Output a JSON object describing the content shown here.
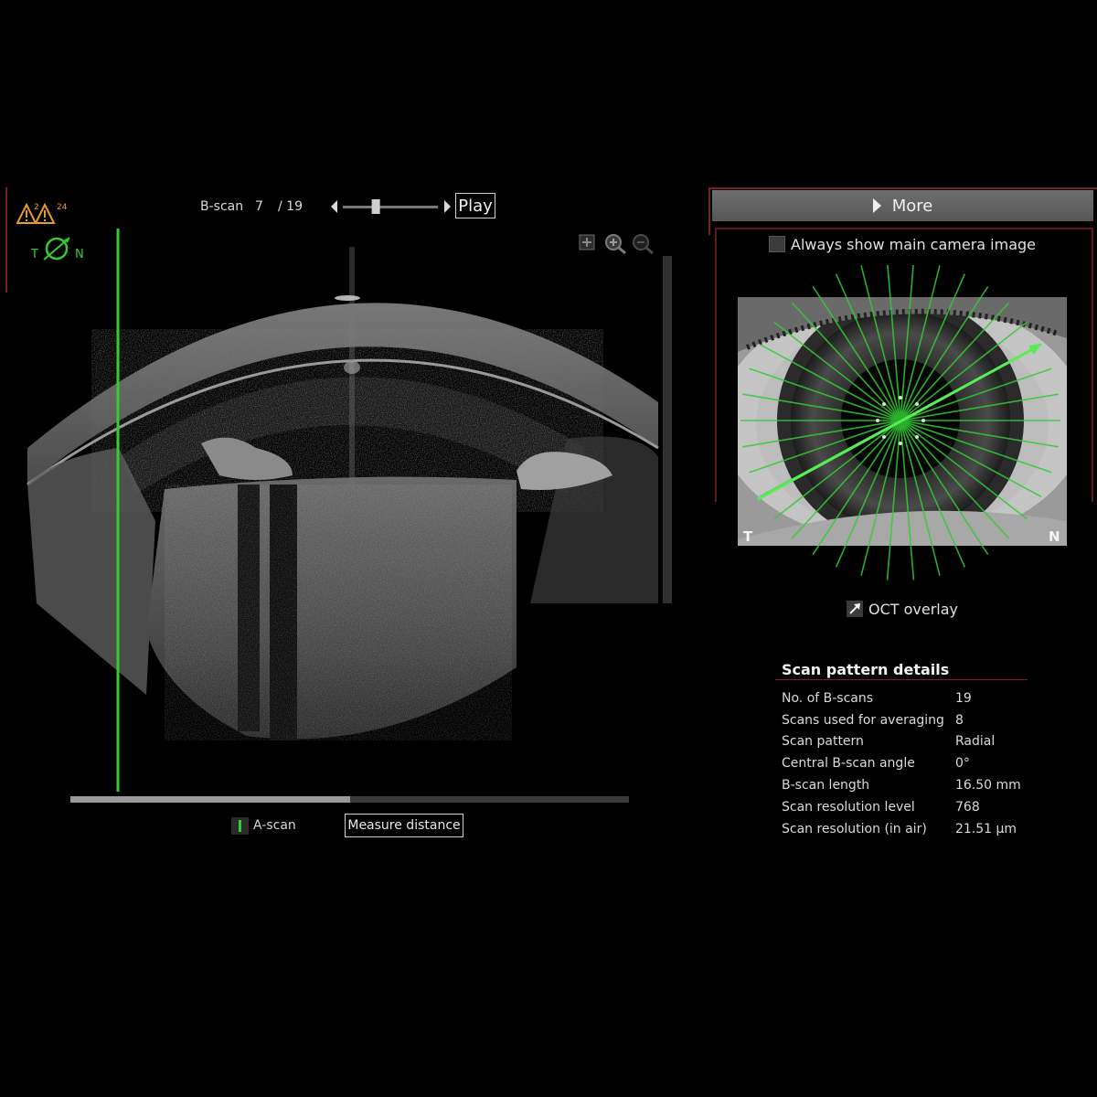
{
  "viewer": {
    "warning": {
      "sup_a": "2",
      "sup_b": "24"
    },
    "orientation": {
      "left": "T",
      "right": "N"
    },
    "bscan": {
      "label": "B-scan",
      "current": "7",
      "total": "/ 19",
      "progress": 0.333
    },
    "play_label": "Play",
    "position_fraction": 0.5,
    "a_scan_label": "A-scan",
    "measure_label": "Measure distance"
  },
  "panel": {
    "more_label": "More",
    "camera_checkbox_label": "Always show main camera image",
    "camera_corner_left": "T",
    "camera_corner_right": "N",
    "oct_overlay_label": "OCT overlay",
    "details": {
      "title": "Scan pattern details",
      "rows": [
        {
          "label": "No. of B-scans",
          "value": "19"
        },
        {
          "label": "Scans used for averaging",
          "value": "8"
        },
        {
          "label": "Scan pattern",
          "value": "Radial"
        },
        {
          "label": "Central B-scan angle",
          "value": "0°"
        },
        {
          "label": "B-scan length",
          "value": "16.50 mm"
        },
        {
          "label": "Scan resolution level",
          "value": "768"
        },
        {
          "label": "Scan resolution (in air)",
          "value": "21.51 µm"
        }
      ]
    }
  },
  "colors": {
    "accent_green": "#33cc33",
    "frame_red": "#7a1f26",
    "warning_orange": "#e89a2c"
  },
  "icons": [
    "warning-icon",
    "eye-orientation-icon",
    "zoom-fit-icon",
    "zoom-in-icon",
    "zoom-out-icon",
    "a-scan-icon",
    "oct-overlay-icon",
    "more-arrow-icon"
  ]
}
